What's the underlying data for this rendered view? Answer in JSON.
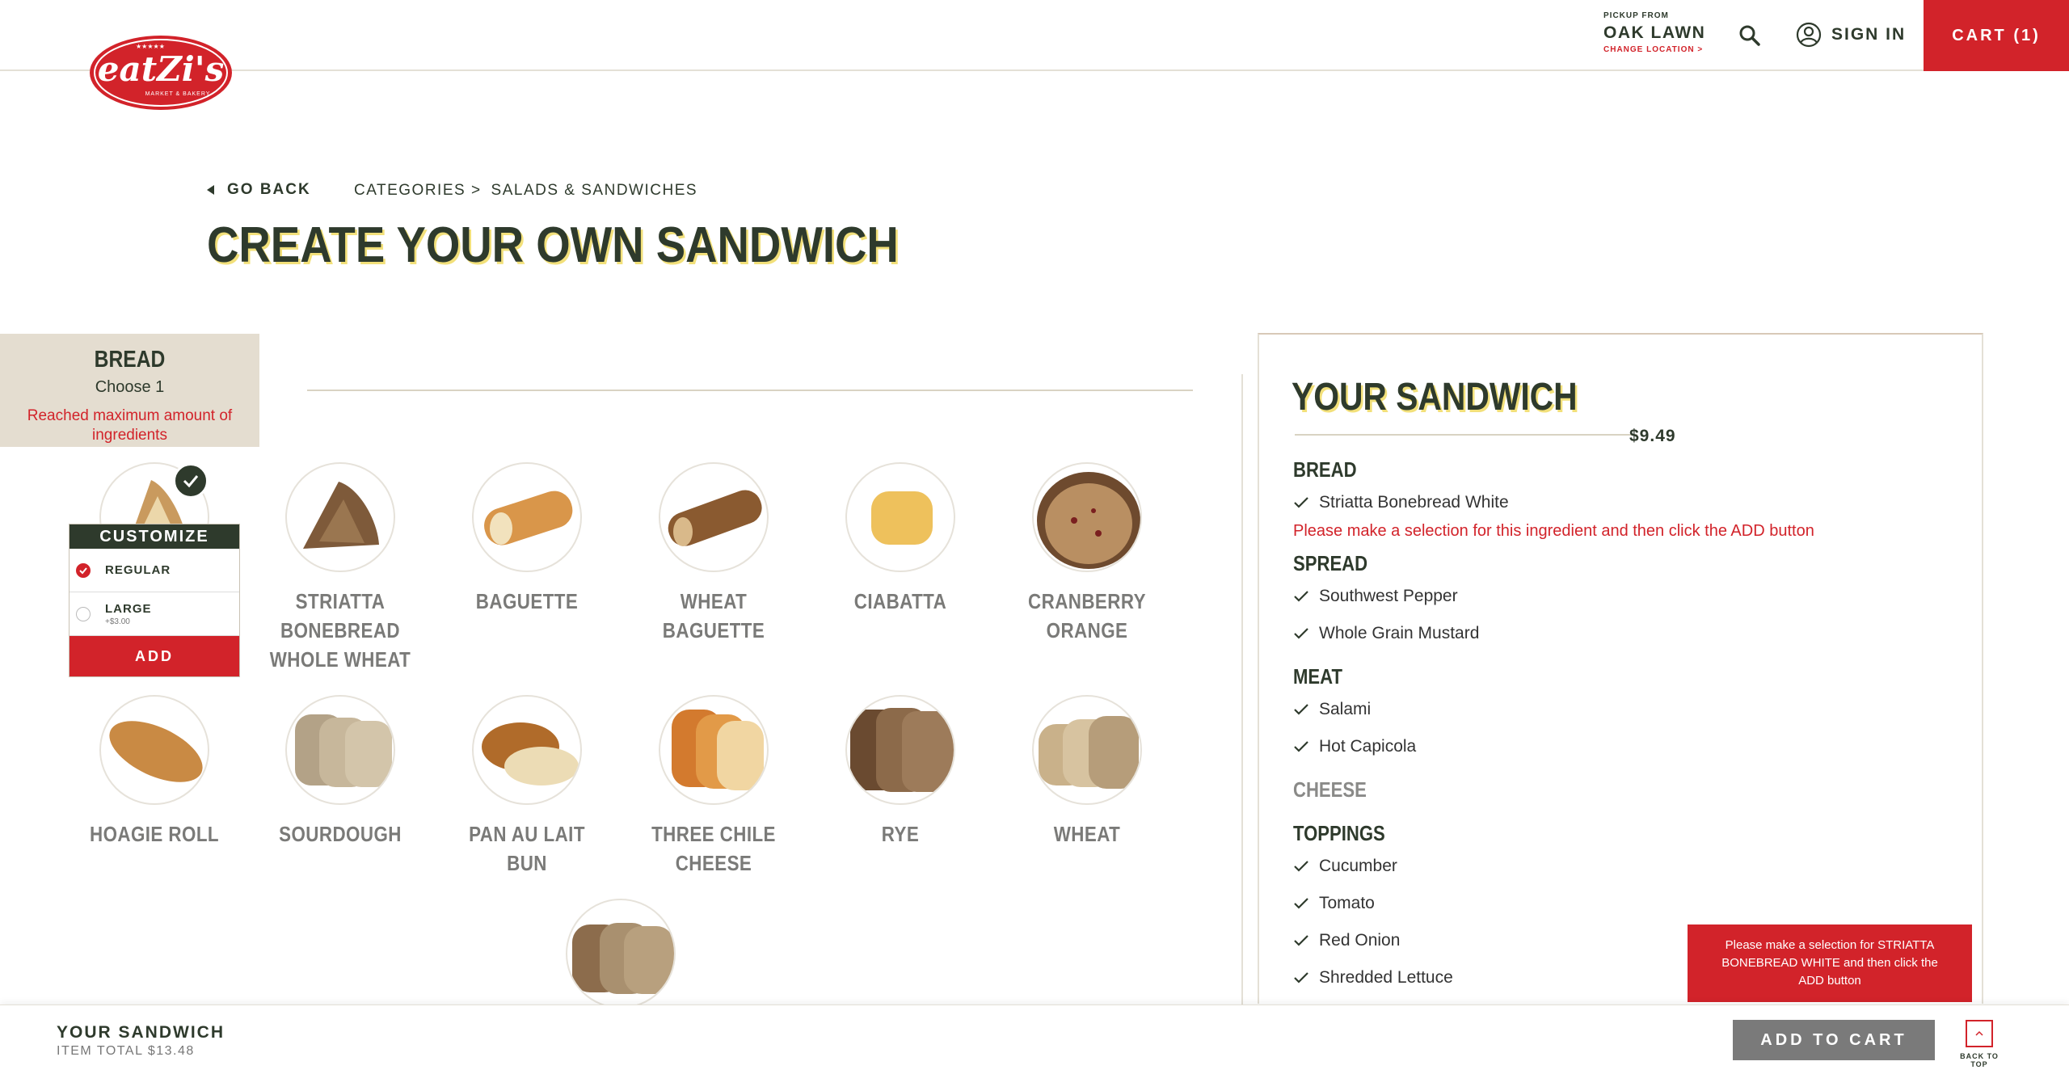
{
  "header": {
    "logo_text": "eatZi's",
    "logo_sub": "MARKET & BAKERY",
    "pickup_label": "PICKUP FROM",
    "pickup_location": "OAK LAWN",
    "change_location": "CHANGE LOCATION >",
    "sign_in": "SIGN IN",
    "cart": "CART (1)"
  },
  "nav": {
    "go_back": "GO BACK",
    "breadcrumb": [
      "CATEGORIES >",
      "SALADS & SANDWICHES"
    ]
  },
  "page_title": "CREATE YOUR OWN SANDWICH",
  "bread_tab": {
    "title": "BREAD",
    "subtitle": "Choose 1",
    "warning": "Reached maximum amount of ingredients"
  },
  "breads": [
    {
      "name": "STRIATTA BONEBREAD WHITE",
      "selected": true
    },
    {
      "name": "STRIATTA BONEBREAD WHOLE WHEAT"
    },
    {
      "name": "BAGUETTE"
    },
    {
      "name": "WHEAT BAGUETTE"
    },
    {
      "name": "CIABATTA"
    },
    {
      "name": "CRANBERRY ORANGE"
    },
    {
      "name": "HOAGIE ROLL"
    },
    {
      "name": "SOURDOUGH"
    },
    {
      "name": "PAN AU LAIT BUN"
    },
    {
      "name": "THREE CHILE CHEESE"
    },
    {
      "name": "RYE"
    },
    {
      "name": "WHEAT"
    },
    {
      "name": ""
    }
  ],
  "customize": {
    "title": "CUSTOMIZE",
    "options": [
      {
        "label": "REGULAR",
        "price": "",
        "selected": true
      },
      {
        "label": "LARGE",
        "price": "+$3.00",
        "selected": false
      }
    ],
    "add": "ADD"
  },
  "sandwich": {
    "title": "YOUR SANDWICH",
    "price": "$9.49",
    "bread_title": "BREAD",
    "bread_items": [
      "Striatta Bonebread White"
    ],
    "bread_warning": "Please make a selection for this ingredient and then click the ADD button",
    "spread_title": "SPREAD",
    "spread_items": [
      "Southwest Pepper",
      "Whole Grain Mustard"
    ],
    "meat_title": "MEAT",
    "meat_items": [
      "Salami",
      "Hot Capicola"
    ],
    "cheese_title": "CHEESE",
    "toppings_title": "TOPPINGS",
    "toppings_items": [
      "Cucumber",
      "Tomato",
      "Red Onion",
      "Shredded Lettuce"
    ]
  },
  "toast": "Please make a selection for STRIATTA BONEBREAD WHITE and then click the ADD button",
  "footer": {
    "title": "YOUR SANDWICH",
    "total": "ITEM TOTAL $13.48",
    "add_to_cart": "ADD TO CART",
    "back_to_top": "BACK TO TOP"
  },
  "colors": {
    "brand_red": "#d2232a",
    "dark_green": "#2e3a2c",
    "title_shadow_yellow": "#f2e07a",
    "tab_bg": "#e4ddd0",
    "disabled_gray": "#7a7a7a"
  }
}
